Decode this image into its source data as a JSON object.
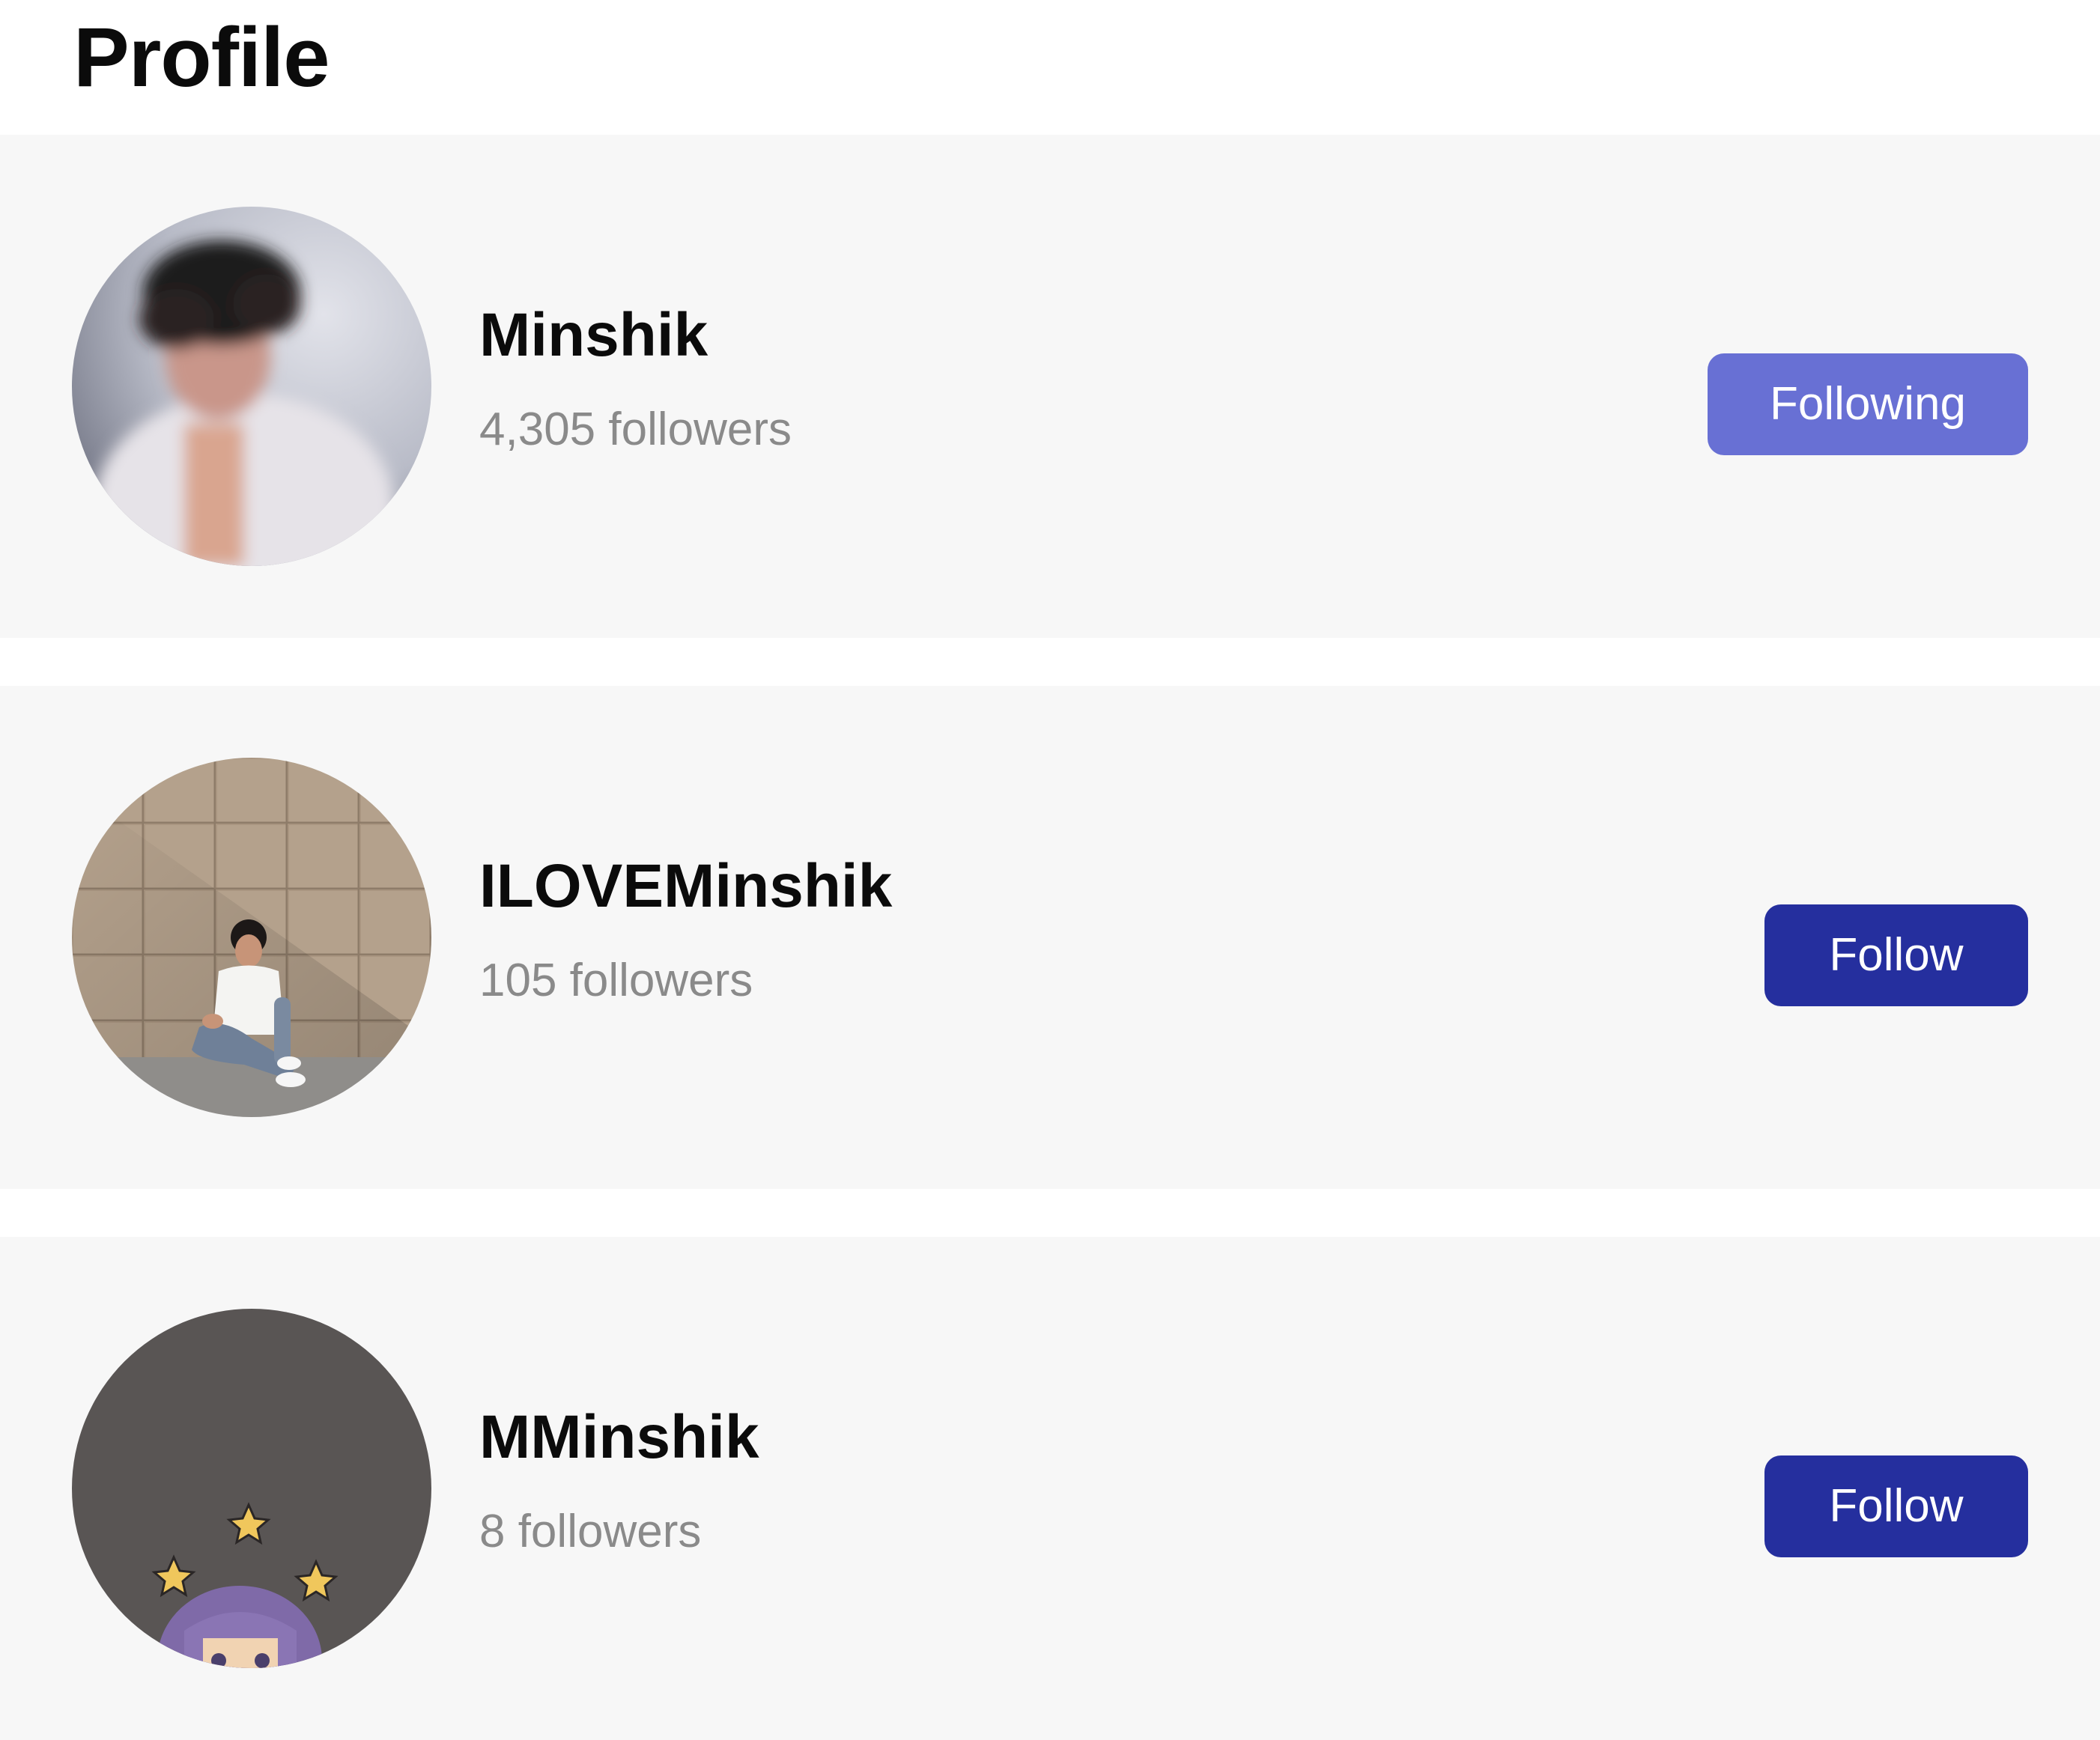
{
  "page": {
    "title": "Profile"
  },
  "profiles": [
    {
      "name": "Minshik",
      "followers": "4,305 followers",
      "button_label": "Following",
      "button_state": "following",
      "avatar_icon": "blurred-portrait-photo"
    },
    {
      "name": "ILOVEMinshik",
      "followers": "105 followers",
      "button_label": "Follow",
      "button_state": "follow",
      "avatar_icon": "person-sitting-by-stone-wall-photo"
    },
    {
      "name": "MMinshik",
      "followers": "8 followers",
      "button_label": "Follow",
      "button_state": "follow",
      "avatar_icon": "anime-character-with-stars-drawing"
    }
  ],
  "colors": {
    "following_button": "#6870d4",
    "follow_button": "#252f9e",
    "row_background": "#f7f7f7",
    "followers_text": "#8a8a8a"
  }
}
